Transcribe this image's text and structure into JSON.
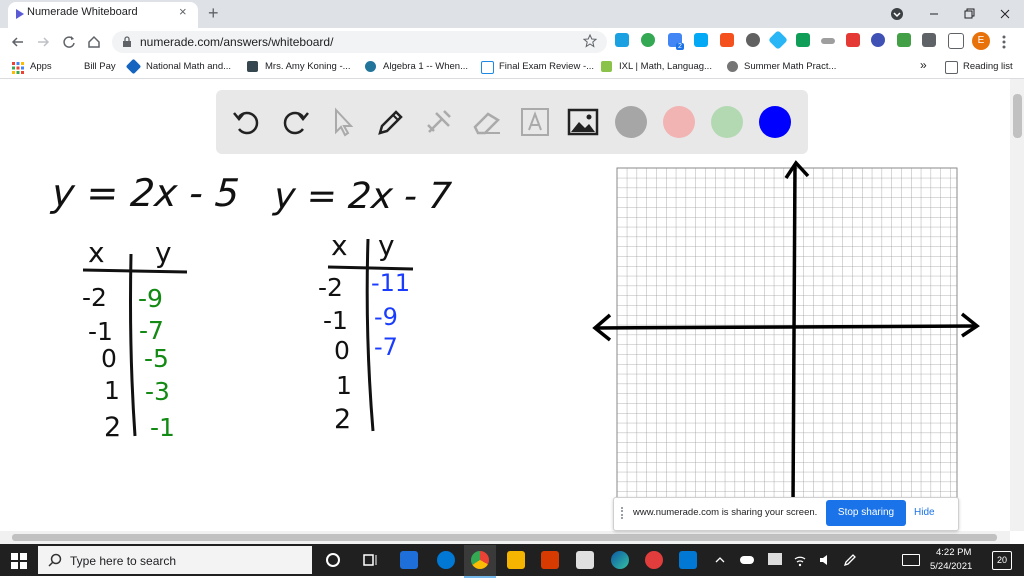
{
  "browser": {
    "tab_title": "Numerade Whiteboard",
    "tab_close": "×",
    "new_tab": "+",
    "url": "numerade.com/answers/whiteboard/",
    "profile_initial": "E",
    "extension_badge": "2"
  },
  "bookmarks": [
    {
      "label": "Apps",
      "color": "#4285f4"
    },
    {
      "label": "Bill Pay",
      "color": "#ffffff"
    },
    {
      "label": "National Math and...",
      "color": "#1565c0"
    },
    {
      "label": "Mrs. Amy Koning -...",
      "color": "#37474f"
    },
    {
      "label": "Algebra 1 -- When...",
      "color": "#21759b"
    },
    {
      "label": "Final Exam Review -...",
      "color": "#1e88e5"
    },
    {
      "label": "IXL | Math, Languag...",
      "color": "#8bc34a"
    },
    {
      "label": "Summer Math Pract...",
      "color": "#757575"
    }
  ],
  "bookmarks_overflow": "»",
  "reading_list": "Reading list",
  "whiteboard": {
    "tools": [
      "undo-icon",
      "redo-icon",
      "pointer-icon",
      "pen-icon",
      "tools-icon",
      "eraser-icon",
      "text-icon",
      "image-icon"
    ],
    "colors": [
      "#a6a6a6",
      "#f2b3b3",
      "#b3d9b3",
      "#0000ff"
    ],
    "equation_1": "y = 2x - 5",
    "equation_2": "y = 2x - 7",
    "table_1": {
      "headers": [
        "x",
        "y"
      ],
      "x": [
        "-2",
        "-1",
        "0",
        "1",
        "2"
      ],
      "y": [
        "-9",
        "-7",
        "-5",
        "-3",
        "-1"
      ]
    },
    "table_2": {
      "headers": [
        "x",
        "y"
      ],
      "x": [
        "-2",
        "-1",
        "0",
        "1",
        "2"
      ],
      "y": [
        "-11",
        "-9",
        "-7"
      ]
    },
    "ink_colors": {
      "black": "#111111",
      "green": "#138a13",
      "blue": "#1a3cff"
    }
  },
  "share_banner": {
    "text": "www.numerade.com is sharing your screen.",
    "stop_label": "Stop sharing",
    "hide_label": "Hide"
  },
  "taskbar": {
    "search_placeholder": "Type here to search",
    "time": "4:22 PM",
    "date": "5/24/2021",
    "notification_count": "20"
  }
}
